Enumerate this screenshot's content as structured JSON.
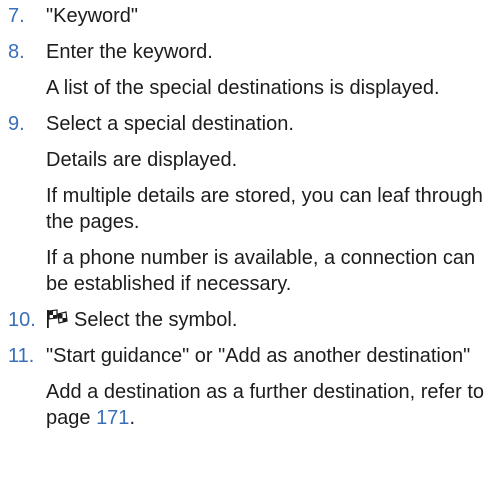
{
  "colors": {
    "accent": "#3a6fb8",
    "text": "#1c1c1c"
  },
  "steps": [
    {
      "number": "7.",
      "text": "\"Keyword\"",
      "notes": []
    },
    {
      "number": "8.",
      "text": "Enter the keyword.",
      "notes": [
        "A list of the special destinations is displayed."
      ]
    },
    {
      "number": "9.",
      "text": "Select a special destination.",
      "notes": [
        "Details are displayed.",
        "If multiple details are stored, you can leaf through the pages.",
        "If a phone number is available, a connection can be established if necessary."
      ]
    },
    {
      "number": "10.",
      "icon": "checkered-flag-icon",
      "text": "Select the symbol.",
      "notes": []
    },
    {
      "number": "11.",
      "text": "\"Start guidance\" or \"Add as another destination\"",
      "notes": [],
      "note_with_link": {
        "before": "Add a destination as a further destination, refer to page ",
        "link": "171",
        "after": "."
      }
    }
  ]
}
